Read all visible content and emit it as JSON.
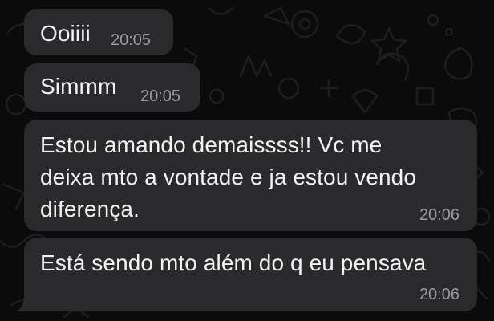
{
  "chat": {
    "messages": [
      {
        "text": "Ooiiii",
        "time": "20:05"
      },
      {
        "text": "Simmm",
        "time": "20:05"
      },
      {
        "text": "Estou amando demaissss!! Vc me deixa mto a vontade e ja estou vendo diferença.",
        "time": "20:06"
      },
      {
        "text": "Está sendo mto além do q eu pensava",
        "time": "20:06"
      }
    ],
    "colors": {
      "background": "#0b0b0b",
      "bubble": "#2a2a2c",
      "text": "#f2f2f2",
      "timestamp": "#9b9b9b"
    }
  }
}
